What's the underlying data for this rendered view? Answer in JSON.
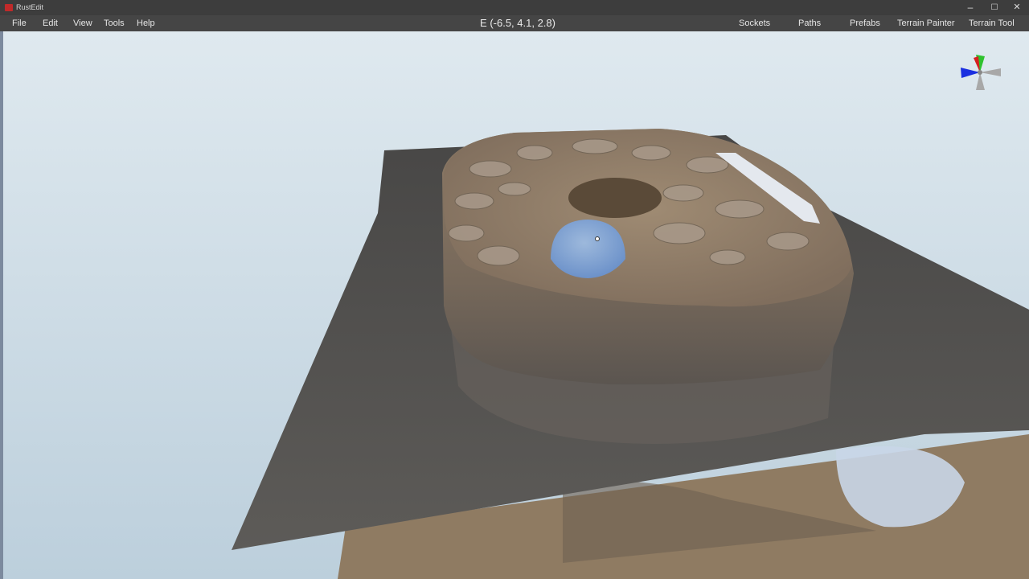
{
  "window": {
    "title": "RustEdit",
    "controls": {
      "minimize": "–",
      "maximize": "☐",
      "close": "✕"
    }
  },
  "menubar": {
    "left_items": [
      "File",
      "Edit",
      "View",
      "Tools",
      "Help"
    ],
    "coords": "E (-6.5, 4.1, 2.8)",
    "right_items": [
      "Sockets",
      "Paths",
      "Prefabs",
      "Terrain Painter",
      "Terrain Tool"
    ]
  },
  "gizmo": {
    "x_color": "#d62020",
    "y_color": "#2ec22e",
    "z_color": "#1a2fe0",
    "neg_color": "#a8a8a8"
  },
  "scene": {
    "sky_top": "#dfe9ef",
    "sky_bottom": "#bfd1de",
    "water_plane": "#4c4b4a",
    "rock": "#8a7763",
    "sand": "#9a8467",
    "sphere": "#7aa8e8"
  }
}
